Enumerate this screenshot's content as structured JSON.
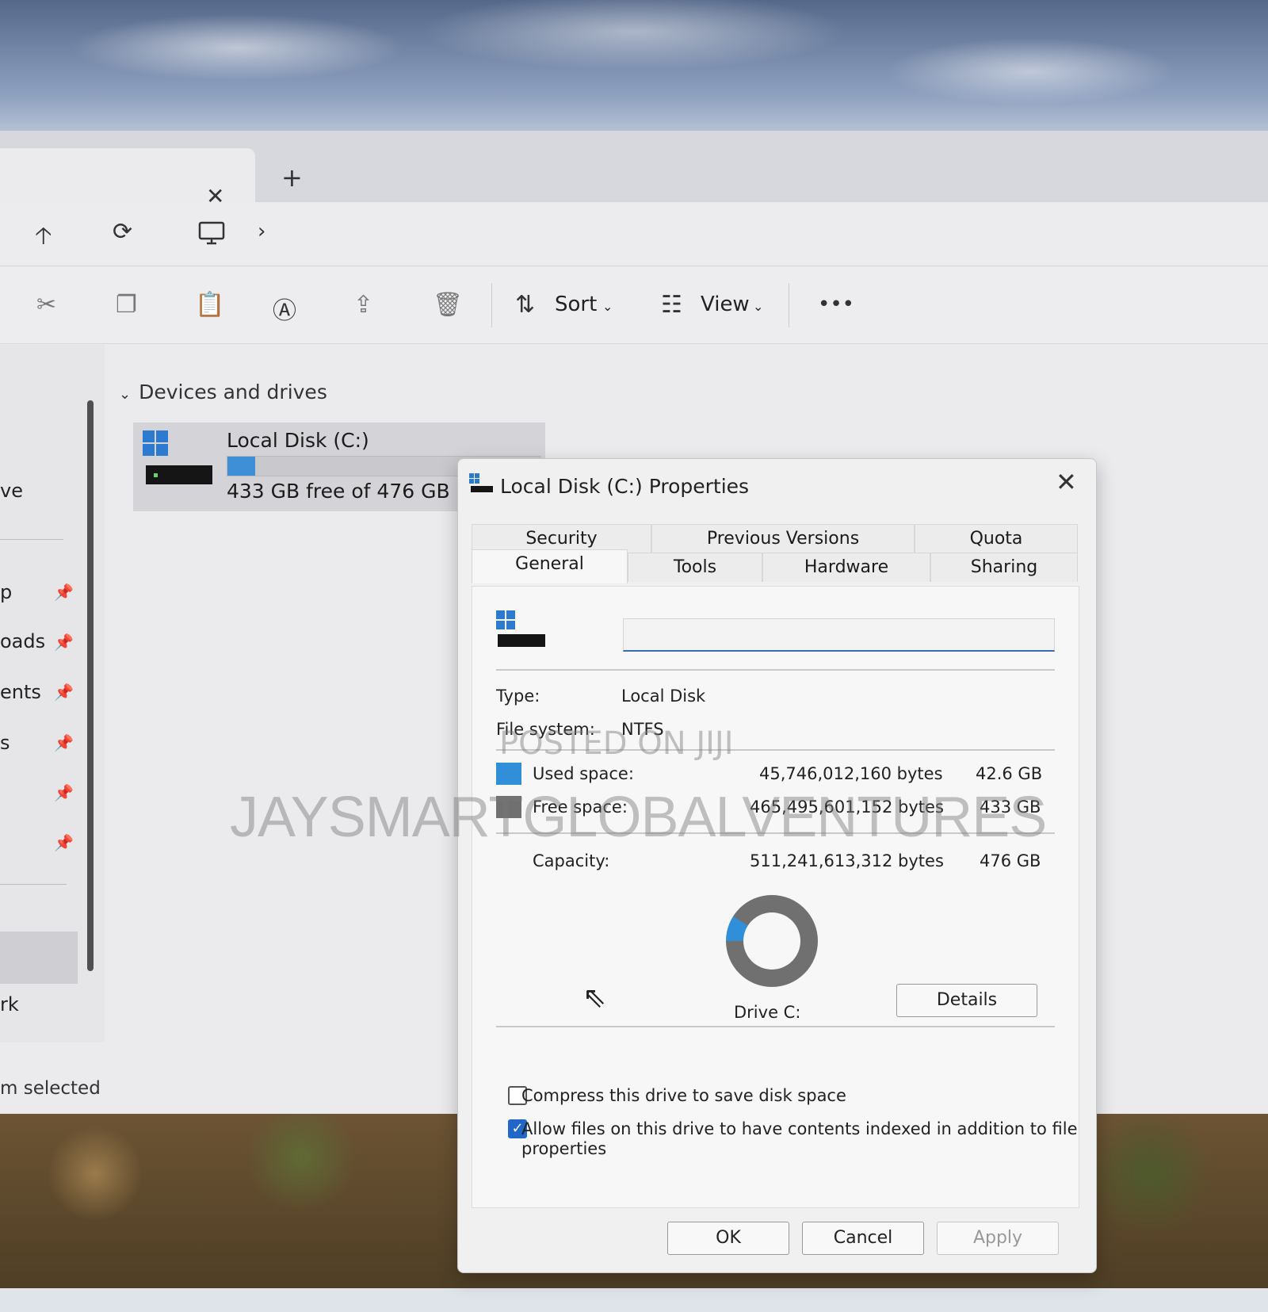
{
  "explorer": {
    "tab_close": "✕",
    "new_tab": "+",
    "toolbar": {
      "sort": "Sort",
      "view": "View",
      "more": "•••"
    },
    "section_header": "Devices and drives",
    "drive": {
      "label": "Local Disk (C:)",
      "free_text": "433 GB free of 476 GB",
      "used_fraction": 0.09
    },
    "sidebar_fragments": [
      "ve",
      "p",
      "oads",
      "ents",
      "s",
      "rk"
    ],
    "status": "m selected"
  },
  "dialog": {
    "title": "Local Disk (C:) Properties",
    "tabs_row1": [
      "Security",
      "Previous Versions",
      "Quota"
    ],
    "tabs_row2": [
      "General",
      "Tools",
      "Hardware",
      "Sharing"
    ],
    "name_value": "",
    "type_label": "Type:",
    "type_value": "Local Disk",
    "fs_label": "File system:",
    "fs_value": "NTFS",
    "used_label": "Used space:",
    "used_bytes": "45,746,012,160 bytes",
    "used_gb": "42.6 GB",
    "free_label": "Free space:",
    "free_bytes": "465,495,601,152 bytes",
    "free_gb": "433 GB",
    "capacity_label": "Capacity:",
    "capacity_bytes": "511,241,613,312 bytes",
    "capacity_gb": "476 GB",
    "drive_caption": "Drive C:",
    "details_button": "Details",
    "compress_label": "Compress this drive to save disk space",
    "compress_checked": false,
    "index_label": "Allow files on this drive to have contents indexed in addition to file",
    "index_label_2": "properties",
    "index_checked": true,
    "ok": "OK",
    "cancel": "Cancel",
    "apply": "Apply",
    "used_fraction": 0.09,
    "used_color": "#2f8fd8",
    "free_color": "#707070"
  },
  "watermarks": {
    "posted": "POSTED ON JIJI",
    "brand": "JAYSMARTGLOBALVENTURES"
  }
}
